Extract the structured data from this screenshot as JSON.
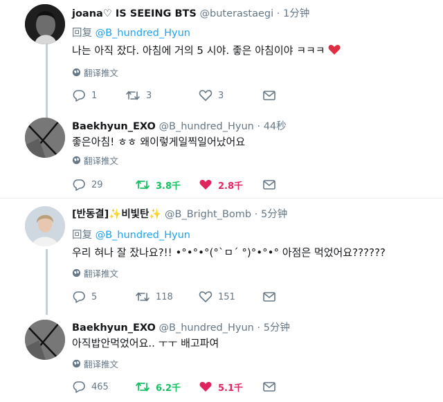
{
  "tweets": [
    {
      "display_name": "joana♡ IS SEEING BTS",
      "handle": "@buterastaegi",
      "time": "1分钟",
      "reply_prefix": "回复",
      "reply_to": "@B_hundred_Hyun",
      "text": "나는 아직 잤다. 아침에 거의 5 시야. 좋은 아침이야 ㅋㅋㅋ",
      "translate": "翻译推文",
      "replies": "1",
      "retweets": "3",
      "likes": "3",
      "liked": false
    },
    {
      "display_name": "Baekhyun_EXO",
      "handle": "@B_hundred_Hyun",
      "time": "44秒",
      "text": "좋은아침! ㅎㅎ 왜이렇게일찍일어났어요",
      "translate": "翻译推文",
      "replies": "29",
      "retweets": "3.8千",
      "likes": "2.8千",
      "liked": true
    },
    {
      "display_name": "[반동결]✨비빛탄✨",
      "handle": "@B_Bright_Bomb",
      "time": "5分钟",
      "reply_prefix": "回复",
      "reply_to": "@B_hundred_Hyun",
      "text": "우리 혀나 잘 잤나요?!! •°•°•°(°`ㅁ´ °)°•°•° 아점은 먹었어요??????",
      "translate": "翻译推文",
      "replies": "5",
      "retweets": "118",
      "likes": "151",
      "liked": false
    },
    {
      "display_name": "Baekhyun_EXO",
      "handle": "@B_hundred_Hyun",
      "time": "5分钟",
      "text": "아직밥안먹었어요.. ㅜㅜ 배고파여",
      "translate": "翻译推文",
      "replies": "465",
      "retweets": "6.2千",
      "likes": "5.1千",
      "liked": true
    }
  ],
  "separator_dot": "·",
  "colors": {
    "link": "#1da1f2",
    "secondary": "#657786",
    "retweet_active": "#17bf63",
    "like_active": "#e0245e",
    "thread_line": "#c4cfd6"
  }
}
